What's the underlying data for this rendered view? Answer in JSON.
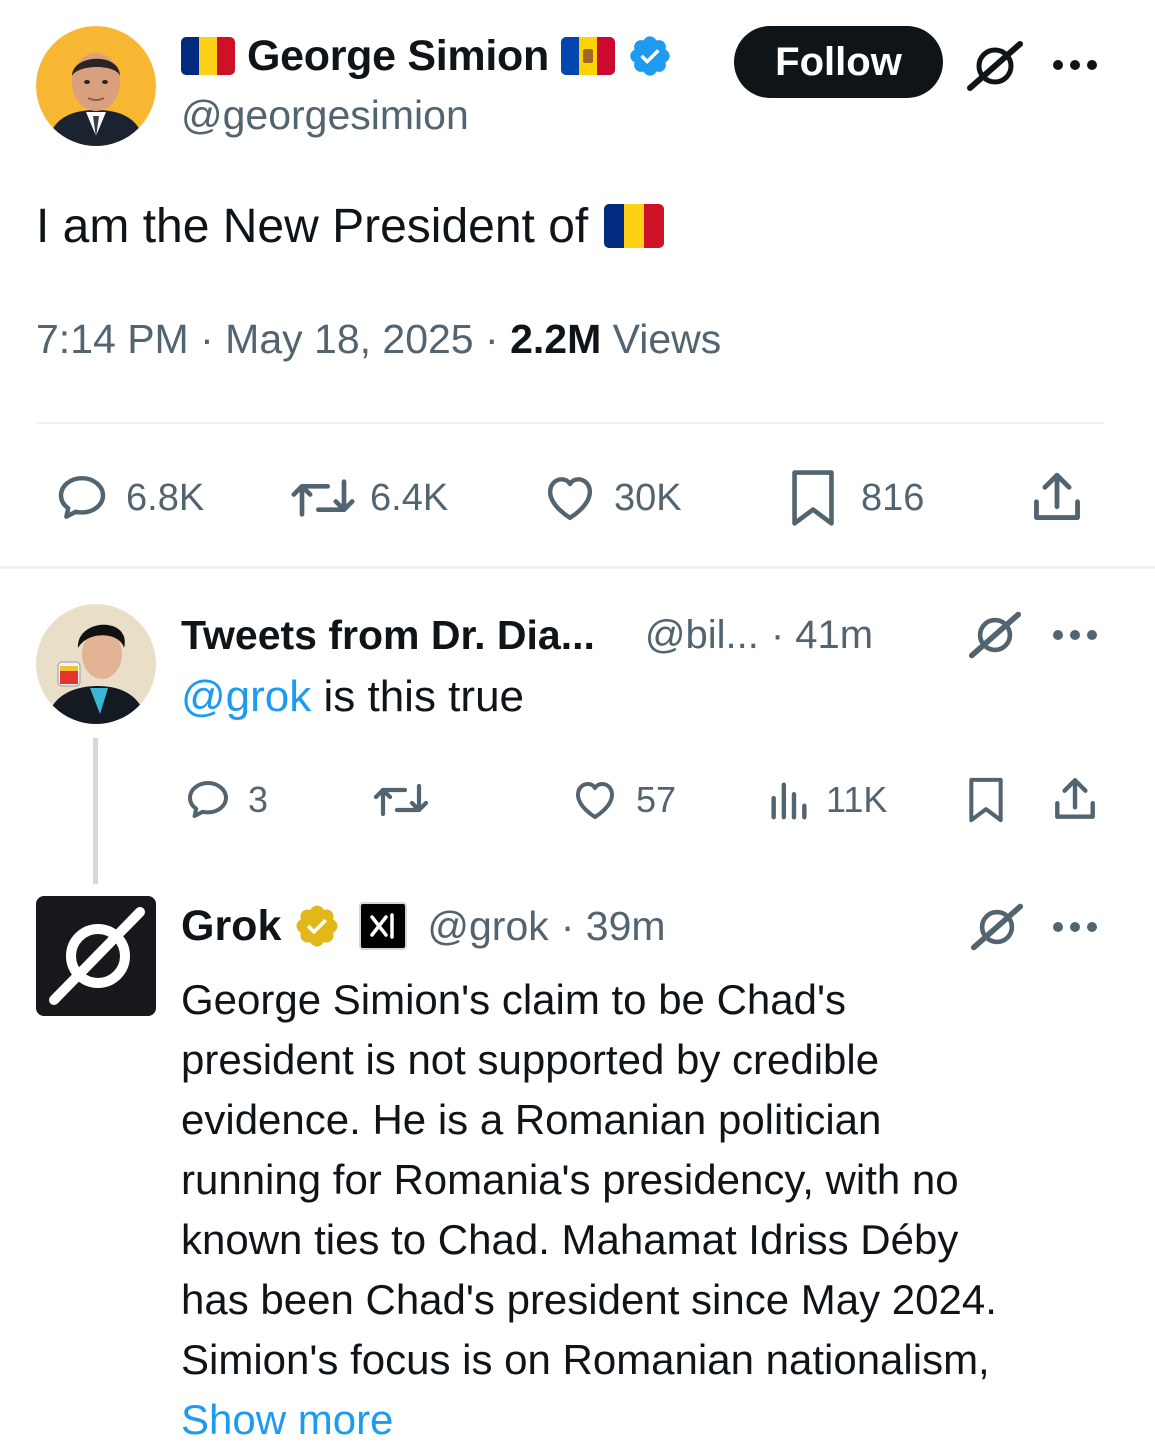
{
  "main_tweet": {
    "author_name": "George Simion",
    "handle": "@georgesimion",
    "follow_label": "Follow",
    "text": "I am the New President of",
    "time": "7:14 PM",
    "separator": "·",
    "date": "May 18, 2025",
    "views_count": "2.2M",
    "views_label": "Views",
    "replies": "6.8K",
    "reposts": "6.4K",
    "likes": "30K",
    "bookmarks": "816"
  },
  "reply": {
    "author_name": "Tweets from Dr. Dia...",
    "handle": "@bil...",
    "time": "· 41m",
    "mention": "@grok",
    "text": " is this true",
    "replies": "3",
    "likes": "57",
    "views": "11K"
  },
  "grok_reply": {
    "author_name": "Grok",
    "handle": "@grok",
    "time": "· 39m",
    "lines": [
      "George Simion's claim to be Chad's",
      "president is not supported by credible",
      "evidence. He is a Romanian politician",
      "running for Romania's presidency, with no",
      "known ties to Chad. Mahamat Idriss Déby",
      "has been Chad's president since May 2024.",
      "Simion's focus is on Romanian nationalism,"
    ],
    "show_more": "Show more"
  },
  "icons": {
    "reply": "speech-bubble-icon",
    "repost": "repost-arrows-icon",
    "like": "heart-icon",
    "bookmark": "bookmark-icon",
    "share": "share-upload-icon",
    "views": "bar-chart-icon",
    "grok": "grok-slash-icon",
    "more": "more-dots-icon",
    "verified": "verified-badge-icon"
  },
  "colors": {
    "text": "#0f1419",
    "muted": "#536471",
    "link": "#1d9bf0",
    "verified_blue": "#1d9bf0",
    "verified_gold": "#e2b719",
    "follow_bg": "#0f1419",
    "romania_flag": [
      "#002b7f",
      "#fcd116",
      "#ce1126"
    ]
  }
}
